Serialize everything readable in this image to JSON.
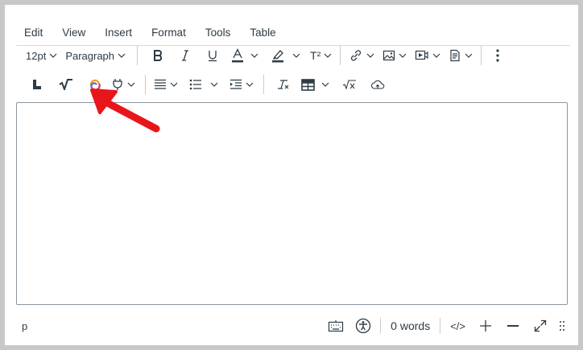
{
  "menubar": {
    "items": [
      "Edit",
      "View",
      "Insert",
      "Format",
      "Tools",
      "Table"
    ]
  },
  "toolbar": {
    "font_size": "12pt",
    "block_format": "Paragraph",
    "superscript_label": "T²"
  },
  "status": {
    "path": "p",
    "word_count": "0 words",
    "html_editor_label": "</>"
  },
  "annotation": {
    "arrow_color": "#e8161b"
  },
  "colors": {
    "text": "#2d3b45",
    "border": "#8b969e",
    "background": "#c8c8c8"
  }
}
